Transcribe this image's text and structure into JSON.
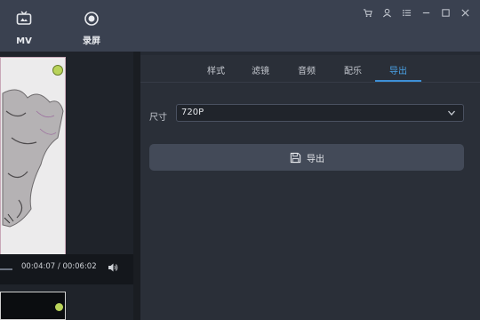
{
  "topbar": {
    "modes": [
      {
        "label": "MV",
        "icon": "tv-icon"
      },
      {
        "label": "录屏",
        "icon": "record-icon"
      }
    ],
    "window_controls": [
      "cart-icon",
      "user-icon",
      "menu-icon",
      "minimize-icon",
      "maximize-icon",
      "close-icon"
    ]
  },
  "player": {
    "time": "00:04:07 / 00:06:02",
    "volume_icon": "volume-icon"
  },
  "panel": {
    "tabs": [
      "样式",
      "滤镜",
      "音频",
      "配乐",
      "导出"
    ],
    "active_tab": "导出",
    "size_label": "尺寸",
    "size_value": "720P",
    "export_label": "导出"
  },
  "colors": {
    "accent": "#3d8fd6",
    "topbar": "#3a4150",
    "panel": "#2a2f38",
    "button": "#434a58"
  }
}
